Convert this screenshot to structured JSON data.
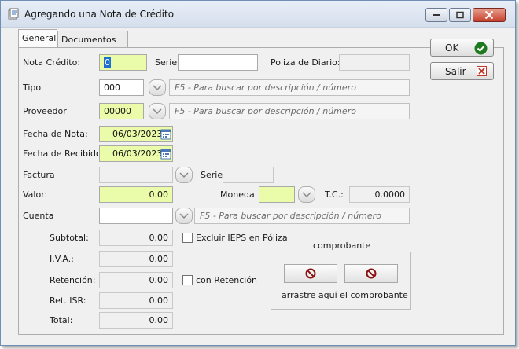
{
  "window": {
    "title": "Agregando una Nota de Crédito"
  },
  "tabs": [
    {
      "label": "General",
      "active": true
    },
    {
      "label": "Documentos",
      "active": false
    }
  ],
  "buttons": {
    "ok": "OK",
    "salir": "Salir"
  },
  "form": {
    "nota_credito": {
      "label": "Nota Crédito:",
      "value": "0"
    },
    "serie": {
      "label": "Serie",
      "value": ""
    },
    "poliza": {
      "label": "Poliza de Diario:",
      "value": ""
    },
    "tipo": {
      "label": "Tipo",
      "value": "000",
      "hint": "F5 - Para buscar por descripción / número"
    },
    "proveedor": {
      "label": "Proveedor",
      "value": "00000",
      "hint": "F5 - Para buscar por descripción / número"
    },
    "fecha_nota": {
      "label": "Fecha de Nota:",
      "value": "06/03/2023"
    },
    "fecha_recibido": {
      "label": "Fecha de Recibido:",
      "value": "06/03/2023"
    },
    "factura": {
      "label": "Factura",
      "value": ""
    },
    "factura_serie": {
      "label": "Serie",
      "value": ""
    },
    "valor": {
      "label": "Valor:",
      "value": "0.00"
    },
    "moneda": {
      "label": "Moneda",
      "value": ""
    },
    "tc": {
      "label": "T.C.:",
      "value": "0.0000"
    },
    "cuenta": {
      "label": "Cuenta",
      "value": "",
      "hint": "F5 - Para buscar por descripción / número"
    }
  },
  "totals": {
    "subtotal": {
      "label": "Subtotal:",
      "value": "0.00"
    },
    "iva": {
      "label": "I.V.A.:",
      "value": "0.00"
    },
    "retencion": {
      "label": "Retención:",
      "value": "0.00"
    },
    "ret_isr": {
      "label": "Ret. ISR:",
      "value": "0.00"
    },
    "total": {
      "label": "Total:",
      "value": "0.00"
    }
  },
  "checkboxes": {
    "excluir_ieps": {
      "label": "Excluir IEPS en Póliza",
      "checked": false
    },
    "con_retencion": {
      "label": "con Retención",
      "checked": false
    }
  },
  "comprobante": {
    "title": "comprobante",
    "drop_text": "arrastre aquí el comprobante"
  },
  "colors": {
    "required_field": "#eafcaa",
    "titlebar": "#dbe4f0",
    "ok_check": "#1e7a1e",
    "salir_x": "#c0392b"
  },
  "icons": {
    "app": "notes-icon",
    "ok": "checkmark-icon",
    "salir": "exit-icon",
    "comprobante_buttons": "prohibited-icon"
  }
}
